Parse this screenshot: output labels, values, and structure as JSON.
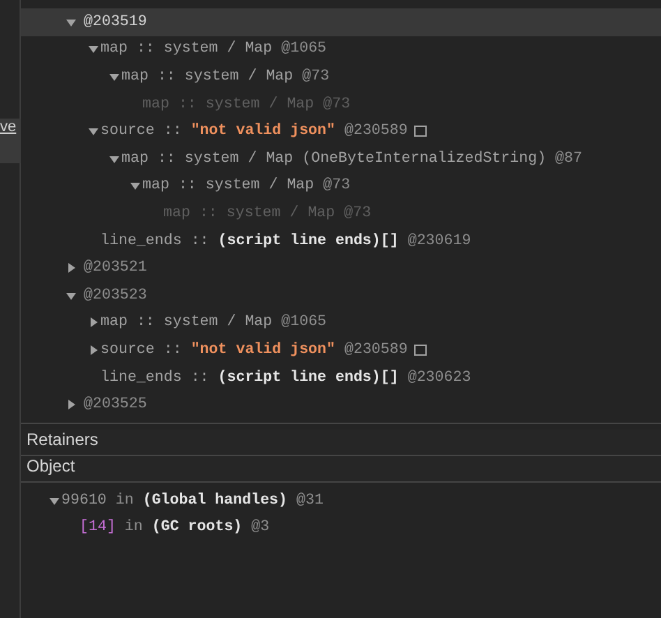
{
  "sidebar": {
    "link": "ve"
  },
  "heap_tree": [
    {
      "id": "@203519",
      "expanded": true,
      "selected": true,
      "dimmed": false,
      "children": [
        {
          "name": "map",
          "separator": "::",
          "type": "system / Map",
          "kind": "system",
          "id": "@1065",
          "expanded": true,
          "selected": false,
          "dimmed": false,
          "children": [
            {
              "name": "map",
              "separator": "::",
              "type": "system / Map",
              "kind": "system",
              "id": "@73",
              "expanded": true,
              "selected": false,
              "dimmed": false,
              "children": [
                {
                  "name": "map",
                  "separator": "::",
                  "type": "system / Map",
                  "kind": "system",
                  "id": "@73",
                  "selected": false,
                  "dimmed": true
                }
              ]
            }
          ]
        },
        {
          "name": "source",
          "separator": "::",
          "type": "\"not valid json\"",
          "kind": "string",
          "id": "@230589",
          "reveal_icon": true,
          "expanded": true,
          "selected": false,
          "dimmed": false,
          "children": [
            {
              "name": "map",
              "separator": "::",
              "type": "system / Map (OneByteInternalizedString)",
              "kind": "system",
              "id": "@87",
              "expanded": true,
              "selected": false,
              "dimmed": false,
              "children": [
                {
                  "name": "map",
                  "separator": "::",
                  "type": "system / Map",
                  "kind": "system",
                  "id": "@73",
                  "expanded": true,
                  "selected": false,
                  "dimmed": false,
                  "children": [
                    {
                      "name": "map",
                      "separator": "::",
                      "type": "system / Map",
                      "kind": "system",
                      "id": "@73",
                      "selected": false,
                      "dimmed": true
                    }
                  ]
                }
              ]
            }
          ]
        },
        {
          "name": "line_ends",
          "separator": "::",
          "type": "(script line ends)[]",
          "kind": "object",
          "id": "@230619",
          "selected": false,
          "dimmed": false
        }
      ]
    },
    {
      "id": "@203521",
      "expanded": false,
      "selected": false,
      "dimmed": false
    },
    {
      "id": "@203523",
      "expanded": true,
      "selected": false,
      "dimmed": false,
      "children": [
        {
          "name": "map",
          "separator": "::",
          "type": "system / Map",
          "kind": "system",
          "id": "@1065",
          "expanded": false,
          "selected": false,
          "dimmed": false
        },
        {
          "name": "source",
          "separator": "::",
          "type": "\"not valid json\"",
          "kind": "string",
          "id": "@230589",
          "reveal_icon": true,
          "expanded": false,
          "selected": false,
          "dimmed": false
        },
        {
          "name": "line_ends",
          "separator": "::",
          "type": "(script line ends)[]",
          "kind": "object",
          "id": "@230623",
          "selected": false,
          "dimmed": false
        }
      ]
    },
    {
      "id": "@203525",
      "expanded": false,
      "selected": false,
      "dimmed": false
    }
  ],
  "retainers": {
    "title": "Retainers",
    "column": "Object",
    "rows": [
      {
        "edge": "99610",
        "color": "#9a9a9a",
        "preposition": "in",
        "object": "(Global handles)",
        "id": "@31",
        "expanded": true,
        "children": [
          {
            "edge": "[14]",
            "color": "#c66fd6",
            "preposition": "in",
            "object": "(GC roots)",
            "id": "@3"
          }
        ]
      }
    ]
  }
}
